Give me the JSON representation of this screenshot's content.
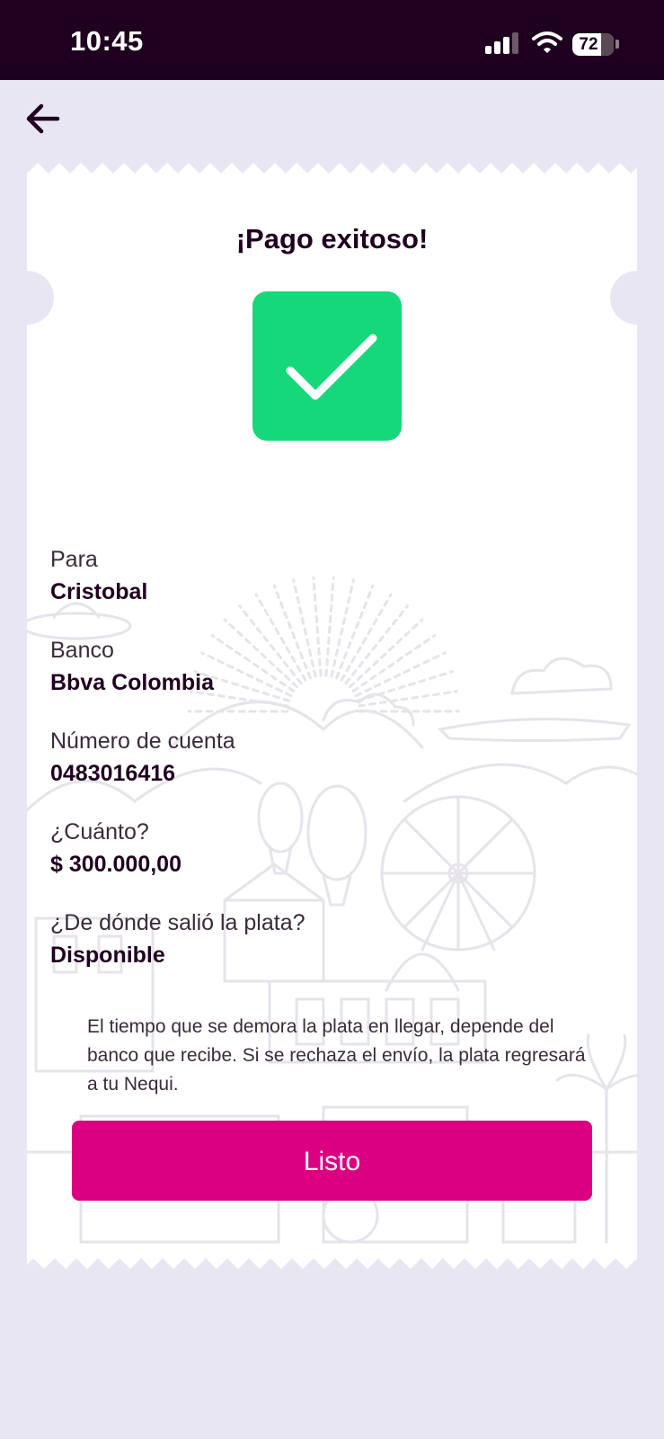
{
  "status_bar": {
    "time": "10:45",
    "battery": "72",
    "icons": [
      "signal-icon",
      "wifi-icon",
      "battery-icon"
    ]
  },
  "header": {
    "back_icon": "arrow-left-icon"
  },
  "receipt": {
    "title": "¡Pago exitoso!",
    "status_icon": "checkmark-icon",
    "fields": [
      {
        "label": "Para",
        "value": "Cristobal"
      },
      {
        "label": "Banco",
        "value": "Bbva Colombia"
      },
      {
        "label": "Número de cuenta",
        "value": "0483016416"
      },
      {
        "label": "¿Cuánto?",
        "value": "$ 300.000,00"
      },
      {
        "label": "¿De dónde salió la plata?",
        "value": "Disponible"
      }
    ],
    "note": "El tiempo que se demora la plata en llegar, depende del banco que recibe. Si se rechaza el envío, la plata regresará a tu Nequi.",
    "button_label": "Listo"
  },
  "colors": {
    "status_bar_bg": "#200020",
    "page_bg": "#e9e6f4",
    "success_green": "#15d87a",
    "primary_button": "#da0081",
    "text_primary": "#200020"
  }
}
